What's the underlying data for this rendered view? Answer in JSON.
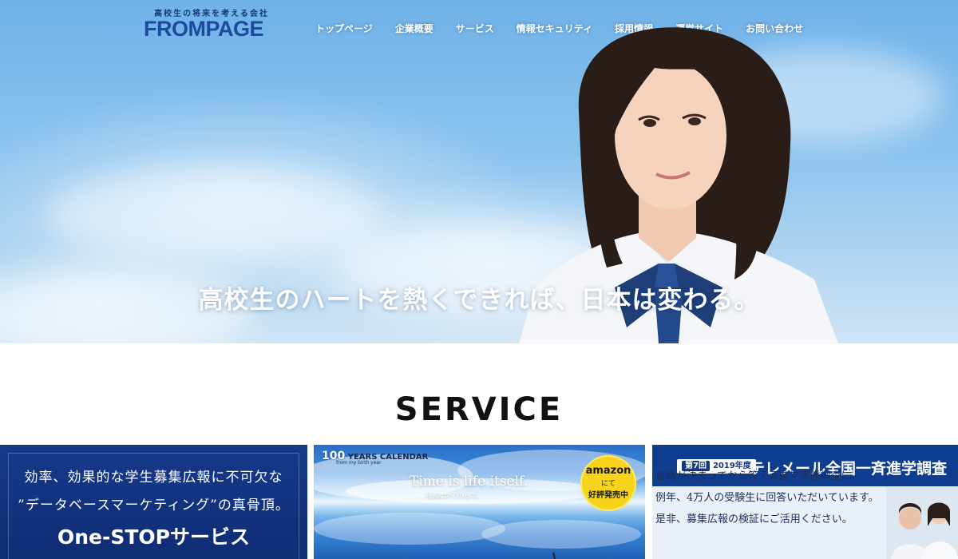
{
  "header": {
    "logo_tagline": "高校生の将来を考える会社",
    "logo_name": "FROMPAGE",
    "nav": [
      {
        "label": "トップページ"
      },
      {
        "label": "企業概要"
      },
      {
        "label": "サービス"
      },
      {
        "label": "情報セキュリティ"
      },
      {
        "label": "採用情報"
      },
      {
        "label": "運営サイト"
      },
      {
        "label": "お問い合わせ"
      }
    ]
  },
  "hero": {
    "tagline": "高校生のハートを熱くできれば、日本は変わる。"
  },
  "service": {
    "title": "SERVICE",
    "cards": [
      {
        "line1": "効率、効果的な学生募集広報に不可欠な",
        "line2": "”データベースマーケティング”の真骨頂。",
        "line3": "One-STOPサービス"
      },
      {
        "head_number": "100",
        "head_label": "YEARS CALENDAR",
        "head_small": "from my birth year",
        "title": "Time is life itself.",
        "subtitle": "時間は命そのもの。",
        "amazon": {
          "brand": "amazon",
          "mid": "にて",
          "bottom": "好評発売中"
        }
      },
      {
        "badge_num": "第7回",
        "badge_year": "2019年度",
        "title": "テレメール全国一斉進学調査",
        "text1": "進路が決まってから答える進学実態調査に、",
        "text2": "例年、4万人の受験生に回答いただいています。",
        "text3": "是非、募集広報の検証にご活用ください。"
      }
    ]
  },
  "colors": {
    "brand_blue": "#1c4a9c",
    "card_navy": "#13449a",
    "amazon_yellow": "#f7d31c"
  }
}
